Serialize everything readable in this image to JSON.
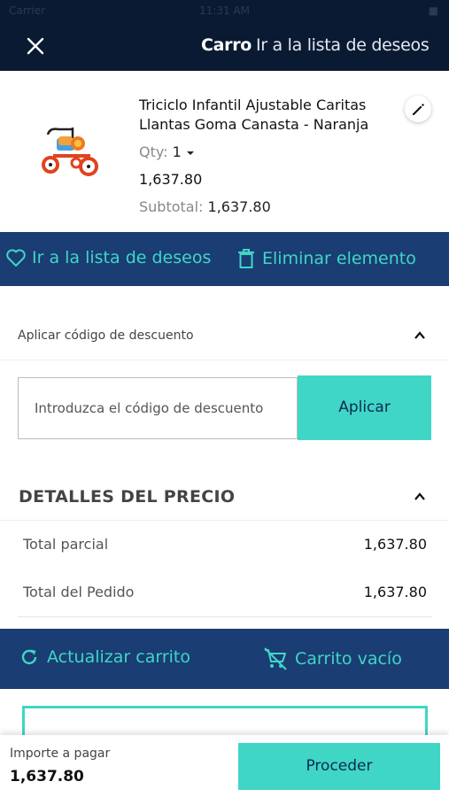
{
  "status_bar": {
    "carrier": "Carrier",
    "time": "11:31 AM",
    "battery": "■"
  },
  "header": {
    "title": "Carro",
    "wishlist_link": "Ir a la lista de deseos"
  },
  "cart_item": {
    "name": "Triciclo Infantil Ajustable Caritas Llantas Goma Canasta - Naranja",
    "qty_label": "Qty:",
    "qty_value": "1",
    "price": "1,637.80",
    "subtotal_label": "Subtotal:",
    "subtotal_value": "1,637.80"
  },
  "item_actions": {
    "wishlist": "Ir a la lista de deseos",
    "remove": "Eliminar elemento"
  },
  "discount": {
    "header": "Aplicar código de descuento",
    "placeholder": "Introduzca el código de descuento",
    "apply": "Aplicar"
  },
  "price_details": {
    "header": "DETALLES DEL PRECIO",
    "rows": [
      {
        "label": "Total parcial",
        "value": "1,637.80"
      },
      {
        "label": "Total del Pedido",
        "value": "1,637.80"
      }
    ]
  },
  "cart_actions": {
    "update": "Actualizar carrito",
    "empty": "Carrito vacío"
  },
  "footer": {
    "amount_label": "Importe a pagar",
    "amount": "1,637.80",
    "proceed": "Proceder"
  },
  "colors": {
    "navy": "#0b1a33",
    "action_bar": "#1a3d73",
    "accent": "#3fd6c6"
  }
}
